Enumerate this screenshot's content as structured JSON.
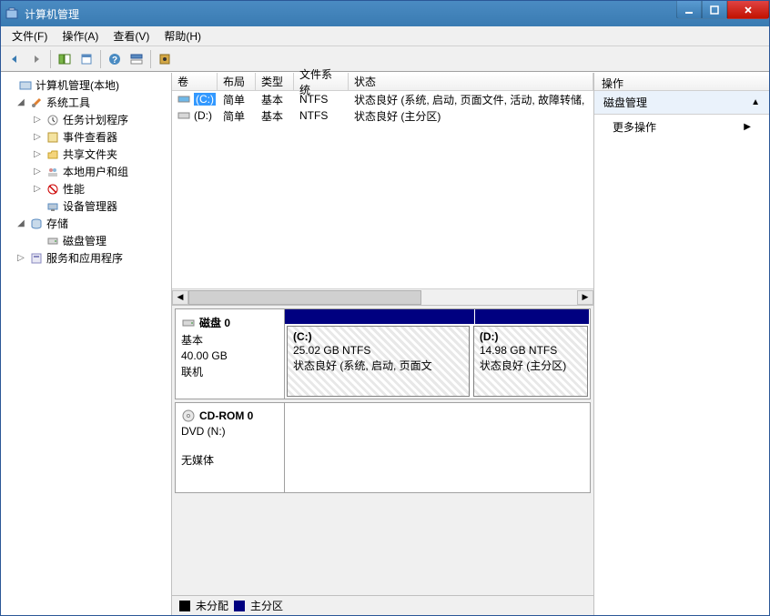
{
  "window": {
    "title": "计算机管理"
  },
  "menu": {
    "file": "文件(F)",
    "action": "操作(A)",
    "view": "查看(V)",
    "help": "帮助(H)"
  },
  "tree": {
    "root": "计算机管理(本地)",
    "systools": "系统工具",
    "scheduler": "任务计划程序",
    "eventviewer": "事件查看器",
    "shared": "共享文件夹",
    "users": "本地用户和组",
    "perf": "性能",
    "devmgr": "设备管理器",
    "storage": "存储",
    "diskmgmt": "磁盘管理",
    "services": "服务和应用程序"
  },
  "vol_headers": {
    "volume": "卷",
    "layout": "布局",
    "type": "类型",
    "fs": "文件系统",
    "status": "状态"
  },
  "volumes": [
    {
      "drive": "(C:)",
      "layout": "简单",
      "type": "基本",
      "fs": "NTFS",
      "status": "状态良好 (系统, 启动, 页面文件, 活动, 故障转储,"
    },
    {
      "drive": "(D:)",
      "layout": "简单",
      "type": "基本",
      "fs": "NTFS",
      "status": "状态良好 (主分区)"
    }
  ],
  "disks": [
    {
      "name": "磁盘 0",
      "kind": "基本",
      "size": "40.00 GB",
      "state": "联机",
      "parts": [
        {
          "label": "(C:)",
          "info": "25.02 GB NTFS",
          "status": "状态良好 (系统, 启动, 页面文",
          "flex": 25
        },
        {
          "label": "(D:)",
          "info": "14.98 GB NTFS",
          "status": "状态良好 (主分区)",
          "flex": 15
        }
      ]
    },
    {
      "name": "CD-ROM 0",
      "kind": "DVD (N:)",
      "size": "",
      "state": "无媒体",
      "parts": []
    }
  ],
  "legend": {
    "unalloc": "未分配",
    "primary": "主分区"
  },
  "actions": {
    "header": "操作",
    "group": "磁盘管理",
    "more": "更多操作"
  }
}
